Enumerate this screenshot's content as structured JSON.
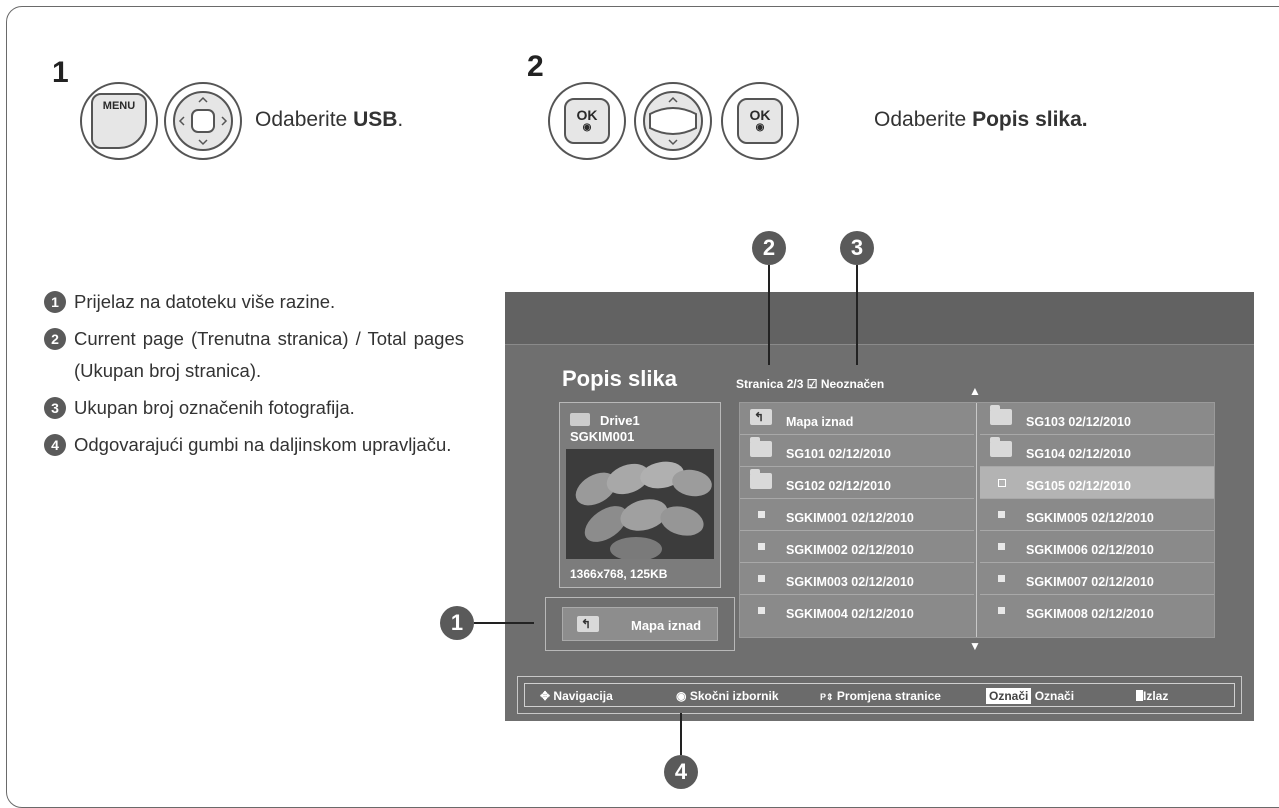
{
  "steps": [
    {
      "number": "1",
      "menu_key": "MENU",
      "text_prefix": "Odaberite ",
      "text_bold": "USB",
      "text_suffix": "."
    },
    {
      "number": "2",
      "ok_key": "OK",
      "text_prefix": "Odaberite ",
      "text_bold": "Popis slika.",
      "text_suffix": ""
    }
  ],
  "notes": [
    {
      "num": "1",
      "text": "Prijelaz na datoteku više razine."
    },
    {
      "num": "2",
      "text": "Current page (Trenutna stranica) / Total pages (Ukupan broj stranica)."
    },
    {
      "num": "3",
      "text": "Ukupan broj označenih fotografija."
    },
    {
      "num": "4",
      "text": "Odgovarajući gumbi na daljinskom upravljaču."
    }
  ],
  "callouts": [
    "1",
    "2",
    "3",
    "4"
  ],
  "screen": {
    "title": "Popis slika",
    "page_info": "Stranica 2/3",
    "checked_info": "Neoznačen",
    "drive": "Drive1",
    "file": "SGKIM001",
    "file_info": "1366x768, 125KB",
    "up_button": "Mapa iznad",
    "files": [
      {
        "label": "Mapa iznad",
        "type": "up"
      },
      {
        "label": "SG103 02/12/2010",
        "type": "folder"
      },
      {
        "label": "SG101 02/12/2010",
        "type": "folder"
      },
      {
        "label": "SG104 02/12/2010",
        "type": "folder"
      },
      {
        "label": "SG102 02/12/2010",
        "type": "folder"
      },
      {
        "label": "SG105 02/12/2010",
        "type": "file",
        "selected": true
      },
      {
        "label": "SGKIM001 02/12/2010",
        "type": "file"
      },
      {
        "label": "SGKIM005 02/12/2010",
        "type": "file"
      },
      {
        "label": "SGKIM002 02/12/2010",
        "type": "file"
      },
      {
        "label": "SGKIM006 02/12/2010",
        "type": "file"
      },
      {
        "label": "SGKIM003 02/12/2010",
        "type": "file"
      },
      {
        "label": "SGKIM007 02/12/2010",
        "type": "file"
      },
      {
        "label": "SGKIM004 02/12/2010",
        "type": "file"
      },
      {
        "label": "SGKIM008 02/12/2010",
        "type": "file"
      }
    ],
    "bottom_bar": {
      "navigation": "Navigacija",
      "popup": "Skočni izbornik",
      "page_change": "Promjena stranice",
      "mark_key": "Označi",
      "mark": "Označi",
      "exit": "Izlaz"
    }
  }
}
